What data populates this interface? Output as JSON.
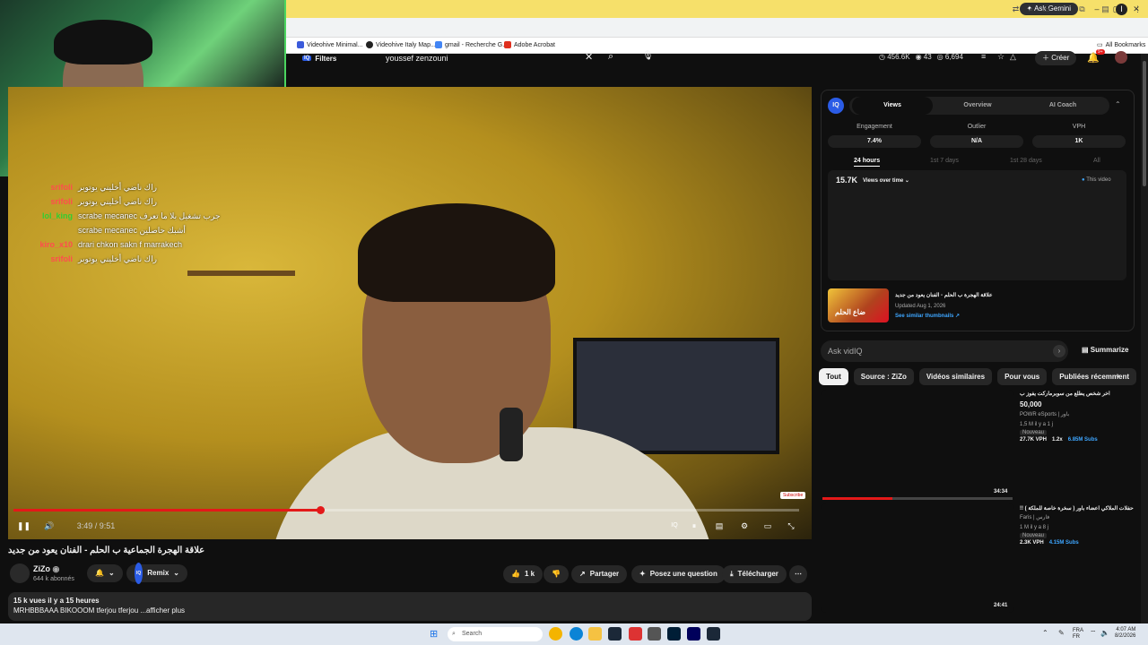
{
  "browser": {
    "gemini_label": "Ask Gemini",
    "window_controls": [
      "–",
      "▢",
      "✕"
    ],
    "bookmarks": [
      {
        "label": "Videohive Minimal...",
        "color": "#3b5bdb"
      },
      {
        "label": "Videohive Italy Map...",
        "color": "#222222"
      },
      {
        "label": "gmail - Recherche G...",
        "color": "#4285f4"
      },
      {
        "label": "Adobe Acrobat",
        "color": "#e0301e"
      }
    ],
    "all_bookmarks": "All Bookmarks"
  },
  "header": {
    "filters_label": "Filters",
    "search_value": "youssef zenzouni",
    "stats": {
      "views": "456.6K",
      "count1": "43",
      "count2": "6,694"
    },
    "create_label": "Créer",
    "notif_count": "9+"
  },
  "chat": [
    {
      "user": "srifoli",
      "color": "#ff4d4d",
      "msg": "راك ناضي أخليني يوتوبر"
    },
    {
      "user": "srifoli",
      "color": "#ff4d4d",
      "msg": "راك ناضي أخليني يوتوبر"
    },
    {
      "user": "lol_king",
      "color": "#32cd32",
      "msg": "scrabe mecanec جرب تشغيل بلا ما تعرف"
    },
    {
      "user": "",
      "color": "#ffffff",
      "msg": "scrabe mecanec أشبك حاصلين"
    },
    {
      "user": "kiro_x10",
      "color": "#ff4d4d",
      "msg": "drari chkon sakn f marrakech"
    },
    {
      "user": "srifoli",
      "color": "#ff4d4d",
      "msg": "راك ناضي أخليني يوتوبر"
    }
  ],
  "player": {
    "progress_fraction": 0.39,
    "time": "3:49 / 9:51",
    "subscribe_badge": "Subscribe"
  },
  "video": {
    "title": "علاقة الهجرة الجماعية ب الحلم - الفنان يعود من جديد",
    "channel": "ZiZo",
    "subscribers": "644 k abonnés",
    "remix": "Remix",
    "likes": "1 k",
    "share": "Partager",
    "ask": "Posez une question",
    "download": "Télécharger",
    "views_line": "15 k vues  il y a 15 heures",
    "desc_line": "MRHBBBAAA BIKOOOM tferjou tferjou ...afficher plus"
  },
  "vidiq": {
    "tabs": [
      "Views",
      "Overview",
      "AI Coach"
    ],
    "metrics": [
      {
        "label": "Engagement",
        "value": "7.4%"
      },
      {
        "label": "Outlier",
        "value": "N/A"
      },
      {
        "label": "VPH",
        "value": "1K"
      }
    ],
    "ranges": [
      "24 hours",
      "1st 7 days",
      "1st 28 days",
      "All"
    ],
    "total_views": "15.7K",
    "chart_selector": "Views over time",
    "legend": "This video",
    "thumb_title": "علاقة الهجرة ب الحلم - الفنان يعود من جديد",
    "updated": "Updated Aug 1, 2026",
    "similar_link": "See similar thumbnails ↗",
    "thumb_text": "ضاع الحلم"
  },
  "ask_box": {
    "placeholder": "Ask vidIQ",
    "summarize": "Summarize"
  },
  "chips": [
    "Tout",
    "Source : ZiZo",
    "Vidéos similaires",
    "Pour vous",
    "Publiées récemment"
  ],
  "recommendations": [
    {
      "title": "اخر شخص يطلع من سوبرماركت يفوز ب",
      "title2": "50,000",
      "channel": "POWR eSports | باور",
      "meta": "1,5 M  il y a 1 j",
      "badge": "Nouveau",
      "vph": "27.7K VPH",
      "mult": "1.2x",
      "subs": "6.85M Subs",
      "duration": "34:34"
    },
    {
      "title": "حفلات الملاكي اعضاء باور ( سخرة خاصة للملكة ) !!",
      "title2": "",
      "channel": "Faris | فارس",
      "meta": "1 M  il y a 8 j",
      "badge": "Nouveau",
      "vph": "2.3K VPH",
      "mult": "",
      "subs": "4.15M Subs",
      "duration": "24:41"
    }
  ],
  "taskbar": {
    "search_label": "Search",
    "lang": "FRA\nFR",
    "time": "4:07 AM",
    "date": "8/2/2026"
  }
}
